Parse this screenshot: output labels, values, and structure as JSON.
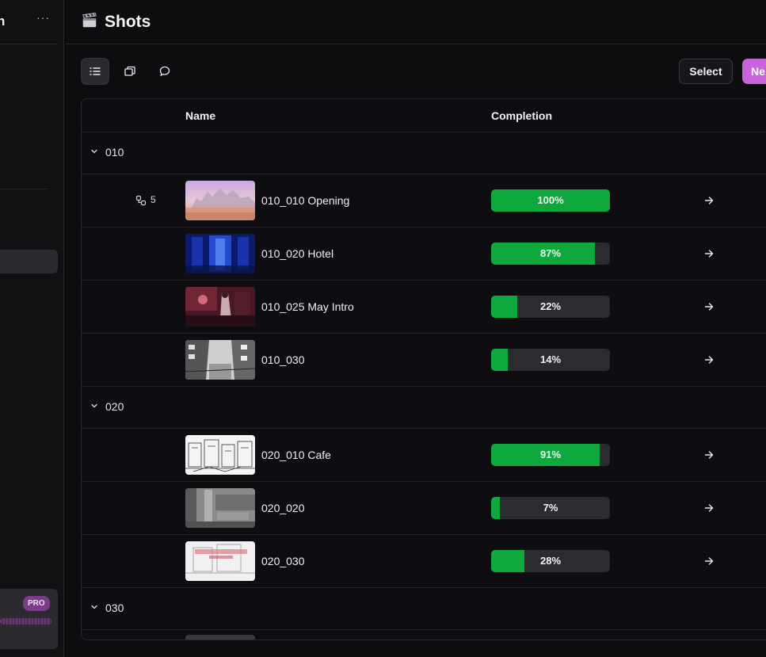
{
  "sidebar": {
    "title_fragment": "n",
    "more_label": "···",
    "pro_badge": "PRO"
  },
  "header": {
    "icon": "clapperboard-icon",
    "title": "Shots"
  },
  "toolbar": {
    "views": [
      "list-view-icon",
      "gallery-view-icon",
      "comments-view-icon"
    ],
    "select_label": "Select",
    "new_label": "Ne"
  },
  "table": {
    "columns": {
      "name": "Name",
      "completion": "Completion"
    },
    "groups": [
      {
        "label": "010",
        "shots": [
          {
            "name": "010_010 Opening",
            "completion": 100,
            "completion_label": "100%",
            "link_count": "5"
          },
          {
            "name": "010_020 Hotel",
            "completion": 87,
            "completion_label": "87%"
          },
          {
            "name": "010_025 May Intro",
            "completion": 22,
            "completion_label": "22%"
          },
          {
            "name": "010_030",
            "completion": 14,
            "completion_label": "14%"
          }
        ]
      },
      {
        "label": "020",
        "shots": [
          {
            "name": "020_010 Cafe",
            "completion": 91,
            "completion_label": "91%"
          },
          {
            "name": "020_020",
            "completion": 7,
            "completion_label": "7%"
          },
          {
            "name": "020_030",
            "completion": 28,
            "completion_label": "28%"
          }
        ]
      },
      {
        "label": "030",
        "shots": []
      }
    ]
  },
  "colors": {
    "background": "#0d0d10",
    "progress_fill": "#0fa83d",
    "progress_track": "#2b2b30",
    "accent_button": "#c764dc",
    "pro_badge": "#7a3d8a"
  }
}
